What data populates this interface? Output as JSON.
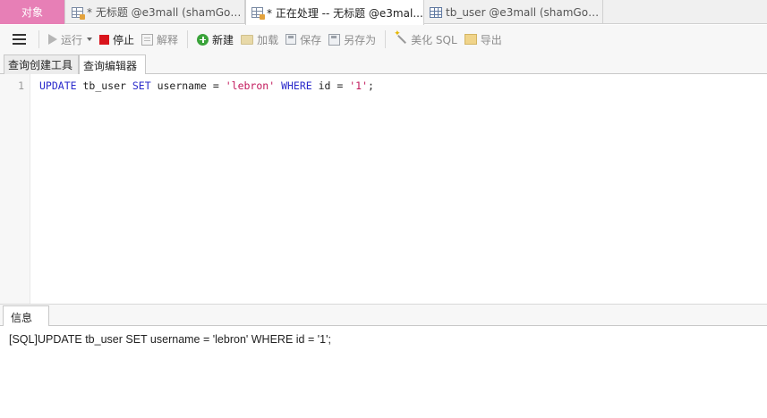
{
  "tabs": [
    {
      "label": "对象"
    },
    {
      "label": "* 无标题 @e3mall (shamGod..."
    },
    {
      "label": "* 正在处理 -- 无标题 @e3mal..."
    },
    {
      "label": "tb_user @e3mall (shamGod..."
    }
  ],
  "toolbar": {
    "run": "运行",
    "stop": "停止",
    "explain": "解释",
    "new": "新建",
    "load": "加载",
    "save": "保存",
    "save_as": "另存为",
    "beautify": "美化 SQL",
    "export": "导出"
  },
  "subtabs": {
    "builder": "查询创建工具",
    "editor": "查询编辑器"
  },
  "editor": {
    "line_number": "1",
    "tokens": {
      "kw_update": "UPDATE",
      "table": " tb_user ",
      "kw_set": "SET",
      "assign": " username = ",
      "val_name": "'lebron'",
      "space": " ",
      "kw_where": "WHERE",
      "cond": " id = ",
      "val_id": "'1'",
      "end": ";"
    }
  },
  "info": {
    "tab_label": "信息",
    "message": "[SQL]UPDATE tb_user SET username = 'lebron' WHERE id = '1';"
  },
  "colors": {
    "objects_tab_bg": "#e77fb6",
    "keyword": "#2a2acb",
    "string": "#c2185b",
    "stop": "#d9141c",
    "new": "#3aa33a"
  }
}
